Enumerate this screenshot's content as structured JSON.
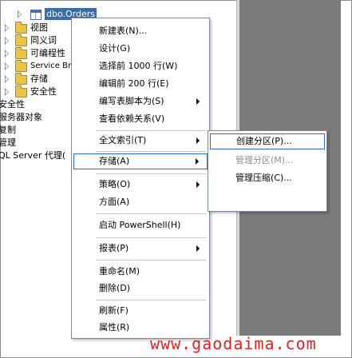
{
  "tree": {
    "selected_node": "dbo.Orders",
    "items": [
      {
        "label": "视图"
      },
      {
        "label": "同义词"
      },
      {
        "label": "可编程性"
      },
      {
        "label": "Service Br"
      },
      {
        "label": "存储"
      },
      {
        "label": "安全性"
      }
    ],
    "partial_items": [
      {
        "label": "安全性"
      },
      {
        "label": "服务器对象"
      },
      {
        "label": "复制"
      },
      {
        "label": "管理"
      },
      {
        "label": "QL Server 代理("
      }
    ]
  },
  "context_menu": {
    "items": [
      {
        "label": "新建表(N)..."
      },
      {
        "label": "设计(G)"
      },
      {
        "label": "选择前 1000 行(W)"
      },
      {
        "label": "编辑前 200 行(E)"
      },
      {
        "label": "编写表脚本为(S)"
      },
      {
        "label": "查看依赖关系(V)"
      },
      {
        "label": "全文索引(T)"
      },
      {
        "label": "存储(A)"
      },
      {
        "label": "策略(O)"
      },
      {
        "label": "方面(A)"
      },
      {
        "label": "启动 PowerShell(H)"
      },
      {
        "label": "报表(P)"
      },
      {
        "label": "重命名(M)"
      },
      {
        "label": "删除(D)"
      },
      {
        "label": "刷新(F)"
      },
      {
        "label": "属性(R)"
      }
    ]
  },
  "submenu": {
    "items": [
      {
        "label": "创建分区(P)..."
      },
      {
        "label": "管理分区(M)..."
      },
      {
        "label": "管理压缩(C)..."
      }
    ]
  },
  "watermark": "www.gaodaima.com"
}
